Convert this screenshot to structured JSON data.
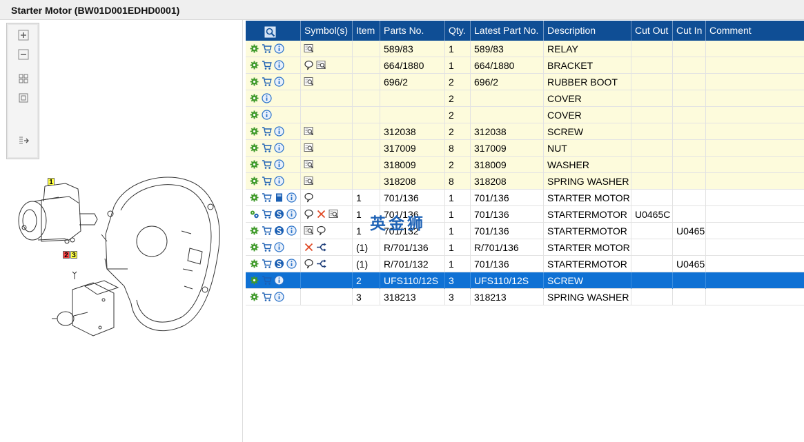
{
  "window": {
    "title": "Starter Motor (BW01D001EDHD0001)"
  },
  "colors": {
    "header_bg": "#0f4e95",
    "row_highlight": "#fdfbdc",
    "row_selected": "#0f71d4",
    "gear_green": "#3f9a2a",
    "cart_blue": "#1b5fb3",
    "info_blue": "#2a72c9",
    "cross_red": "#e04a26"
  },
  "toolbar": {
    "buttons": [
      {
        "name": "zoom-in-icon"
      },
      {
        "name": "zoom-out-icon"
      },
      {
        "name": "fit-all-icon"
      },
      {
        "name": "actual-size-icon"
      },
      {
        "name": "export-icon"
      }
    ]
  },
  "diagram": {
    "callouts": [
      "1",
      "2",
      "3"
    ]
  },
  "watermark": "英金狮",
  "grid": {
    "columns": [
      "",
      "Symbol(s)",
      "Item",
      "Parts No.",
      "Qty.",
      "Latest Part No.",
      "Description",
      "Cut Out",
      "Cut In",
      "Comment"
    ],
    "rows": [
      {
        "style": "yel",
        "actions": [
          "gear",
          "cart",
          "info"
        ],
        "symbols": [
          "magnify"
        ],
        "item": "",
        "part": "589/83",
        "qty": "1",
        "latest": "589/83",
        "desc": "RELAY",
        "cutout": "",
        "cutin": "",
        "comment": ""
      },
      {
        "style": "yel",
        "actions": [
          "gear",
          "cart",
          "info"
        ],
        "symbols": [
          "bubble",
          "magnify"
        ],
        "item": "",
        "part": "664/1880",
        "qty": "1",
        "latest": "664/1880",
        "desc": "BRACKET",
        "cutout": "",
        "cutin": "",
        "comment": ""
      },
      {
        "style": "yel",
        "actions": [
          "gear",
          "cart",
          "info"
        ],
        "symbols": [
          "magnify"
        ],
        "item": "",
        "part": "696/2",
        "qty": "2",
        "latest": "696/2",
        "desc": "RUBBER BOOT",
        "cutout": "",
        "cutin": "",
        "comment": ""
      },
      {
        "style": "yel",
        "actions": [
          "gear",
          "info"
        ],
        "symbols": [],
        "item": "",
        "part": "",
        "qty": "2",
        "latest": "",
        "desc": "COVER",
        "cutout": "",
        "cutin": "",
        "comment": ""
      },
      {
        "style": "yel",
        "actions": [
          "gear",
          "info"
        ],
        "symbols": [],
        "item": "",
        "part": "",
        "qty": "2",
        "latest": "",
        "desc": "COVER",
        "cutout": "",
        "cutin": "",
        "comment": ""
      },
      {
        "style": "yel",
        "actions": [
          "gear",
          "cart",
          "info"
        ],
        "symbols": [
          "magnify"
        ],
        "item": "",
        "part": "312038",
        "qty": "2",
        "latest": "312038",
        "desc": "SCREW",
        "cutout": "",
        "cutin": "",
        "comment": ""
      },
      {
        "style": "yel",
        "actions": [
          "gear",
          "cart",
          "info"
        ],
        "symbols": [
          "magnify"
        ],
        "item": "",
        "part": "317009",
        "qty": "8",
        "latest": "317009",
        "desc": "NUT",
        "cutout": "",
        "cutin": "",
        "comment": ""
      },
      {
        "style": "yel",
        "actions": [
          "gear",
          "cart",
          "info"
        ],
        "symbols": [
          "magnify"
        ],
        "item": "",
        "part": "318009",
        "qty": "2",
        "latest": "318009",
        "desc": "WASHER",
        "cutout": "",
        "cutin": "",
        "comment": ""
      },
      {
        "style": "yel",
        "actions": [
          "gear",
          "cart",
          "info"
        ],
        "symbols": [
          "magnify"
        ],
        "item": "",
        "part": "318208",
        "qty": "8",
        "latest": "318208",
        "desc": "SPRING WASHER",
        "cutout": "",
        "cutin": "",
        "comment": ""
      },
      {
        "style": "wht",
        "actions": [
          "gear",
          "cart",
          "book",
          "info"
        ],
        "symbols": [
          "bubble"
        ],
        "item": "1",
        "part": "701/136",
        "qty": "1",
        "latest": "701/136",
        "desc": "STARTER MOTOR",
        "cutout": "",
        "cutin": "",
        "comment": ""
      },
      {
        "style": "wht",
        "actions": [
          "gears",
          "cart",
          "s",
          "info"
        ],
        "symbols": [
          "bubble",
          "cross",
          "magnify"
        ],
        "item": "1",
        "part": "701/136",
        "qty": "1",
        "latest": "701/136",
        "desc": "STARTERMOTOR",
        "cutout": "U0465C",
        "cutin": "",
        "comment": ""
      },
      {
        "style": "wht",
        "actions": [
          "gear",
          "cart",
          "s",
          "info"
        ],
        "symbols": [
          "magnify",
          "bubble"
        ],
        "item": "1",
        "part": "701/132",
        "qty": "1",
        "latest": "701/136",
        "desc": "STARTERMOTOR",
        "cutout": "",
        "cutin": "U0465",
        "comment": ""
      },
      {
        "style": "wht",
        "actions": [
          "gear",
          "cart",
          "info"
        ],
        "symbols": [
          "cross",
          "branch"
        ],
        "item": "(1)",
        "part": "R/701/136",
        "qty": "1",
        "latest": "R/701/136",
        "desc": "STARTER MOTOR -",
        "cutout": "",
        "cutin": "",
        "comment": ""
      },
      {
        "style": "wht",
        "actions": [
          "gear",
          "cart",
          "s",
          "info"
        ],
        "symbols": [
          "bubble",
          "branch"
        ],
        "item": "(1)",
        "part": "R/701/132",
        "qty": "1",
        "latest": "701/136",
        "desc": "STARTERMOTOR",
        "cutout": "",
        "cutin": "U0465",
        "comment": ""
      },
      {
        "style": "sel",
        "actions": [
          "gear",
          "cart",
          "info"
        ],
        "symbols": [],
        "item": "2",
        "part": "UFS110/12S",
        "qty": "3",
        "latest": "UFS110/12S",
        "desc": "SCREW",
        "cutout": "",
        "cutin": "",
        "comment": ""
      },
      {
        "style": "wht",
        "actions": [
          "gear",
          "cart",
          "info"
        ],
        "symbols": [],
        "item": "3",
        "part": "318213",
        "qty": "3",
        "latest": "318213",
        "desc": "SPRING WASHER",
        "cutout": "",
        "cutin": "",
        "comment": ""
      }
    ]
  }
}
